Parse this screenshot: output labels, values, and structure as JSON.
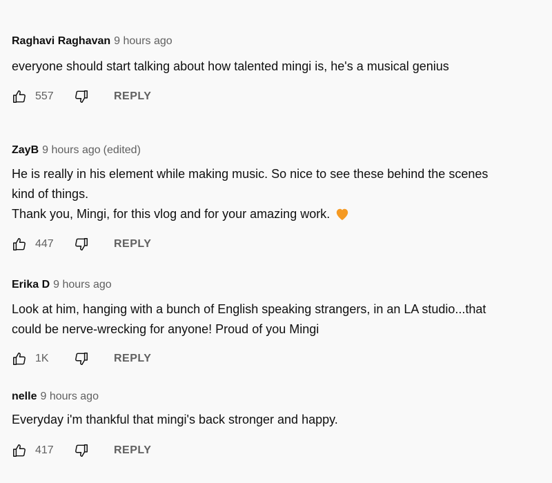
{
  "comments": [
    {
      "author": "Raghavi Raghavan",
      "time": "9 hours ago",
      "edited": "",
      "lines": [
        "everyone should start talking about how talented mingi is, he's a musical genius"
      ],
      "likes": "557",
      "reply_label": "REPLY"
    },
    {
      "author": "ZayB",
      "time": "9 hours ago",
      "edited": "(edited)",
      "lines": [
        "He is really in his element while making music. So nice to see these behind the scenes",
        "kind of things.",
        "Thank you, Mingi, for this vlog and for your amazing work."
      ],
      "emoji": "orange-heart-icon",
      "likes": "447",
      "reply_label": "REPLY"
    },
    {
      "author": "Erika D",
      "time": "9 hours ago",
      "edited": "",
      "lines": [
        "Look at him, hanging with a bunch of English speaking strangers, in an LA studio...that",
        "could be nerve-wrecking for anyone! Proud of you Mingi"
      ],
      "likes": "1K",
      "reply_label": "REPLY"
    },
    {
      "author": "nelle",
      "time": "9 hours ago",
      "edited": "",
      "lines": [
        "Everyday i'm thankful that mingi's back stronger and happy."
      ],
      "likes": "417",
      "reply_label": "REPLY"
    }
  ],
  "colors": {
    "text": "#0f0f0f",
    "secondary": "#606060",
    "background": "#f9f9f9",
    "heart": "#f59a23"
  }
}
